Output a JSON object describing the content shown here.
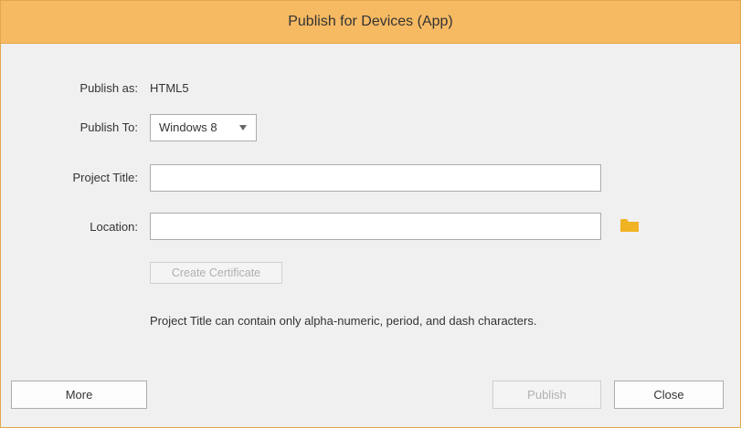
{
  "dialog": {
    "title": "Publish for Devices (App)"
  },
  "form": {
    "publish_as_label": "Publish as:",
    "publish_as_value": "HTML5",
    "publish_to_label": "Publish To:",
    "publish_to_selected": "Windows 8",
    "project_title_label": "Project Title:",
    "project_title_value": "",
    "location_label": "Location:",
    "location_value": "",
    "create_certificate_label": "Create Certificate",
    "note": "Project Title can contain only alpha-numeric, period, and dash characters."
  },
  "footer": {
    "more_label": "More",
    "publish_label": "Publish",
    "close_label": "Close"
  },
  "icons": {
    "folder": "folder-icon"
  },
  "colors": {
    "titlebar": "#f6ba63",
    "folder": "#f0b323"
  }
}
